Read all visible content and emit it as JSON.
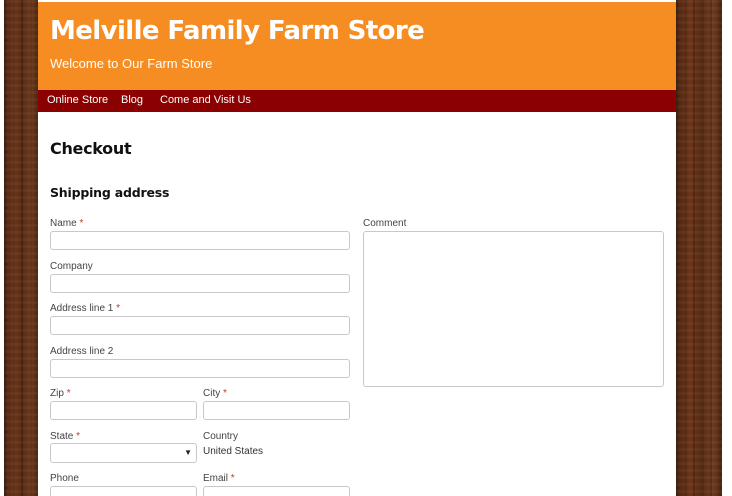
{
  "site": {
    "title": "Melville Family Farm Store",
    "tagline": "Welcome to Our Farm Store"
  },
  "nav": {
    "items": [
      "Online Store",
      "Blog",
      "Come and Visit Us"
    ]
  },
  "page": {
    "title": "Checkout",
    "section_title": "Shipping address"
  },
  "form": {
    "required_marker": "*",
    "name_label": "Name",
    "company_label": "Company",
    "address1_label": "Address line 1",
    "address2_label": "Address line 2",
    "zip_label": "Zip",
    "city_label": "City",
    "state_label": "State",
    "country_label": "Country",
    "country_value": "United States",
    "phone_label": "Phone",
    "email_label": "Email",
    "comment_label": "Comment",
    "name_value": "",
    "company_value": "",
    "address1_value": "",
    "address2_value": "",
    "zip_value": "",
    "city_value": "",
    "state_value": "",
    "phone_value": "",
    "email_value": "",
    "comment_value": ""
  },
  "colors": {
    "header_bg": "#f68d23",
    "nav_bg": "#8b0000",
    "wood": "#5a2d14"
  },
  "icons": {
    "select_arrow": "chevron-down-icon"
  }
}
